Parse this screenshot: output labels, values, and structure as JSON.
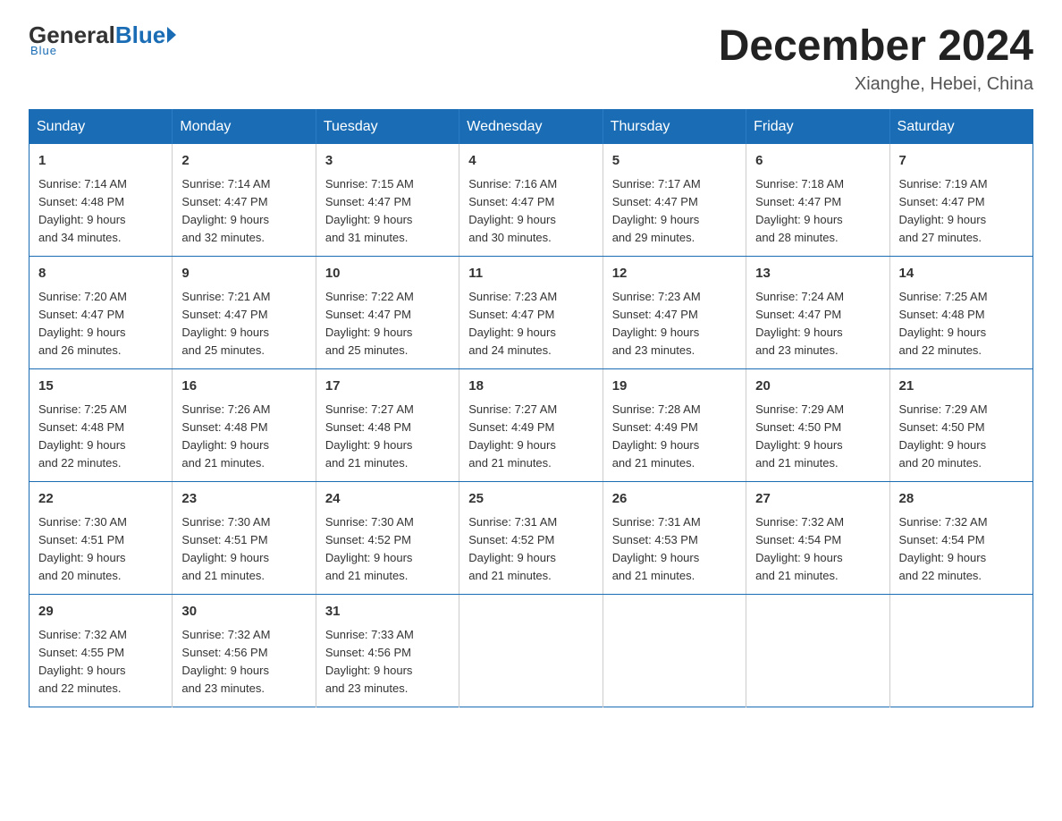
{
  "logo": {
    "general": "General",
    "blue": "Blue",
    "underline": "Blue"
  },
  "title": "December 2024",
  "subtitle": "Xianghe, Hebei, China",
  "days_of_week": [
    "Sunday",
    "Monday",
    "Tuesday",
    "Wednesday",
    "Thursday",
    "Friday",
    "Saturday"
  ],
  "weeks": [
    [
      {
        "day": "1",
        "sunrise": "7:14 AM",
        "sunset": "4:48 PM",
        "daylight": "9 hours and 34 minutes."
      },
      {
        "day": "2",
        "sunrise": "7:14 AM",
        "sunset": "4:47 PM",
        "daylight": "9 hours and 32 minutes."
      },
      {
        "day": "3",
        "sunrise": "7:15 AM",
        "sunset": "4:47 PM",
        "daylight": "9 hours and 31 minutes."
      },
      {
        "day": "4",
        "sunrise": "7:16 AM",
        "sunset": "4:47 PM",
        "daylight": "9 hours and 30 minutes."
      },
      {
        "day": "5",
        "sunrise": "7:17 AM",
        "sunset": "4:47 PM",
        "daylight": "9 hours and 29 minutes."
      },
      {
        "day": "6",
        "sunrise": "7:18 AM",
        "sunset": "4:47 PM",
        "daylight": "9 hours and 28 minutes."
      },
      {
        "day": "7",
        "sunrise": "7:19 AM",
        "sunset": "4:47 PM",
        "daylight": "9 hours and 27 minutes."
      }
    ],
    [
      {
        "day": "8",
        "sunrise": "7:20 AM",
        "sunset": "4:47 PM",
        "daylight": "9 hours and 26 minutes."
      },
      {
        "day": "9",
        "sunrise": "7:21 AM",
        "sunset": "4:47 PM",
        "daylight": "9 hours and 25 minutes."
      },
      {
        "day": "10",
        "sunrise": "7:22 AM",
        "sunset": "4:47 PM",
        "daylight": "9 hours and 25 minutes."
      },
      {
        "day": "11",
        "sunrise": "7:23 AM",
        "sunset": "4:47 PM",
        "daylight": "9 hours and 24 minutes."
      },
      {
        "day": "12",
        "sunrise": "7:23 AM",
        "sunset": "4:47 PM",
        "daylight": "9 hours and 23 minutes."
      },
      {
        "day": "13",
        "sunrise": "7:24 AM",
        "sunset": "4:47 PM",
        "daylight": "9 hours and 23 minutes."
      },
      {
        "day": "14",
        "sunrise": "7:25 AM",
        "sunset": "4:48 PM",
        "daylight": "9 hours and 22 minutes."
      }
    ],
    [
      {
        "day": "15",
        "sunrise": "7:25 AM",
        "sunset": "4:48 PM",
        "daylight": "9 hours and 22 minutes."
      },
      {
        "day": "16",
        "sunrise": "7:26 AM",
        "sunset": "4:48 PM",
        "daylight": "9 hours and 21 minutes."
      },
      {
        "day": "17",
        "sunrise": "7:27 AM",
        "sunset": "4:48 PM",
        "daylight": "9 hours and 21 minutes."
      },
      {
        "day": "18",
        "sunrise": "7:27 AM",
        "sunset": "4:49 PM",
        "daylight": "9 hours and 21 minutes."
      },
      {
        "day": "19",
        "sunrise": "7:28 AM",
        "sunset": "4:49 PM",
        "daylight": "9 hours and 21 minutes."
      },
      {
        "day": "20",
        "sunrise": "7:29 AM",
        "sunset": "4:50 PM",
        "daylight": "9 hours and 21 minutes."
      },
      {
        "day": "21",
        "sunrise": "7:29 AM",
        "sunset": "4:50 PM",
        "daylight": "9 hours and 20 minutes."
      }
    ],
    [
      {
        "day": "22",
        "sunrise": "7:30 AM",
        "sunset": "4:51 PM",
        "daylight": "9 hours and 20 minutes."
      },
      {
        "day": "23",
        "sunrise": "7:30 AM",
        "sunset": "4:51 PM",
        "daylight": "9 hours and 21 minutes."
      },
      {
        "day": "24",
        "sunrise": "7:30 AM",
        "sunset": "4:52 PM",
        "daylight": "9 hours and 21 minutes."
      },
      {
        "day": "25",
        "sunrise": "7:31 AM",
        "sunset": "4:52 PM",
        "daylight": "9 hours and 21 minutes."
      },
      {
        "day": "26",
        "sunrise": "7:31 AM",
        "sunset": "4:53 PM",
        "daylight": "9 hours and 21 minutes."
      },
      {
        "day": "27",
        "sunrise": "7:32 AM",
        "sunset": "4:54 PM",
        "daylight": "9 hours and 21 minutes."
      },
      {
        "day": "28",
        "sunrise": "7:32 AM",
        "sunset": "4:54 PM",
        "daylight": "9 hours and 22 minutes."
      }
    ],
    [
      {
        "day": "29",
        "sunrise": "7:32 AM",
        "sunset": "4:55 PM",
        "daylight": "9 hours and 22 minutes."
      },
      {
        "day": "30",
        "sunrise": "7:32 AM",
        "sunset": "4:56 PM",
        "daylight": "9 hours and 23 minutes."
      },
      {
        "day": "31",
        "sunrise": "7:33 AM",
        "sunset": "4:56 PM",
        "daylight": "9 hours and 23 minutes."
      },
      null,
      null,
      null,
      null
    ]
  ],
  "labels": {
    "sunrise": "Sunrise:",
    "sunset": "Sunset:",
    "daylight": "Daylight:"
  }
}
